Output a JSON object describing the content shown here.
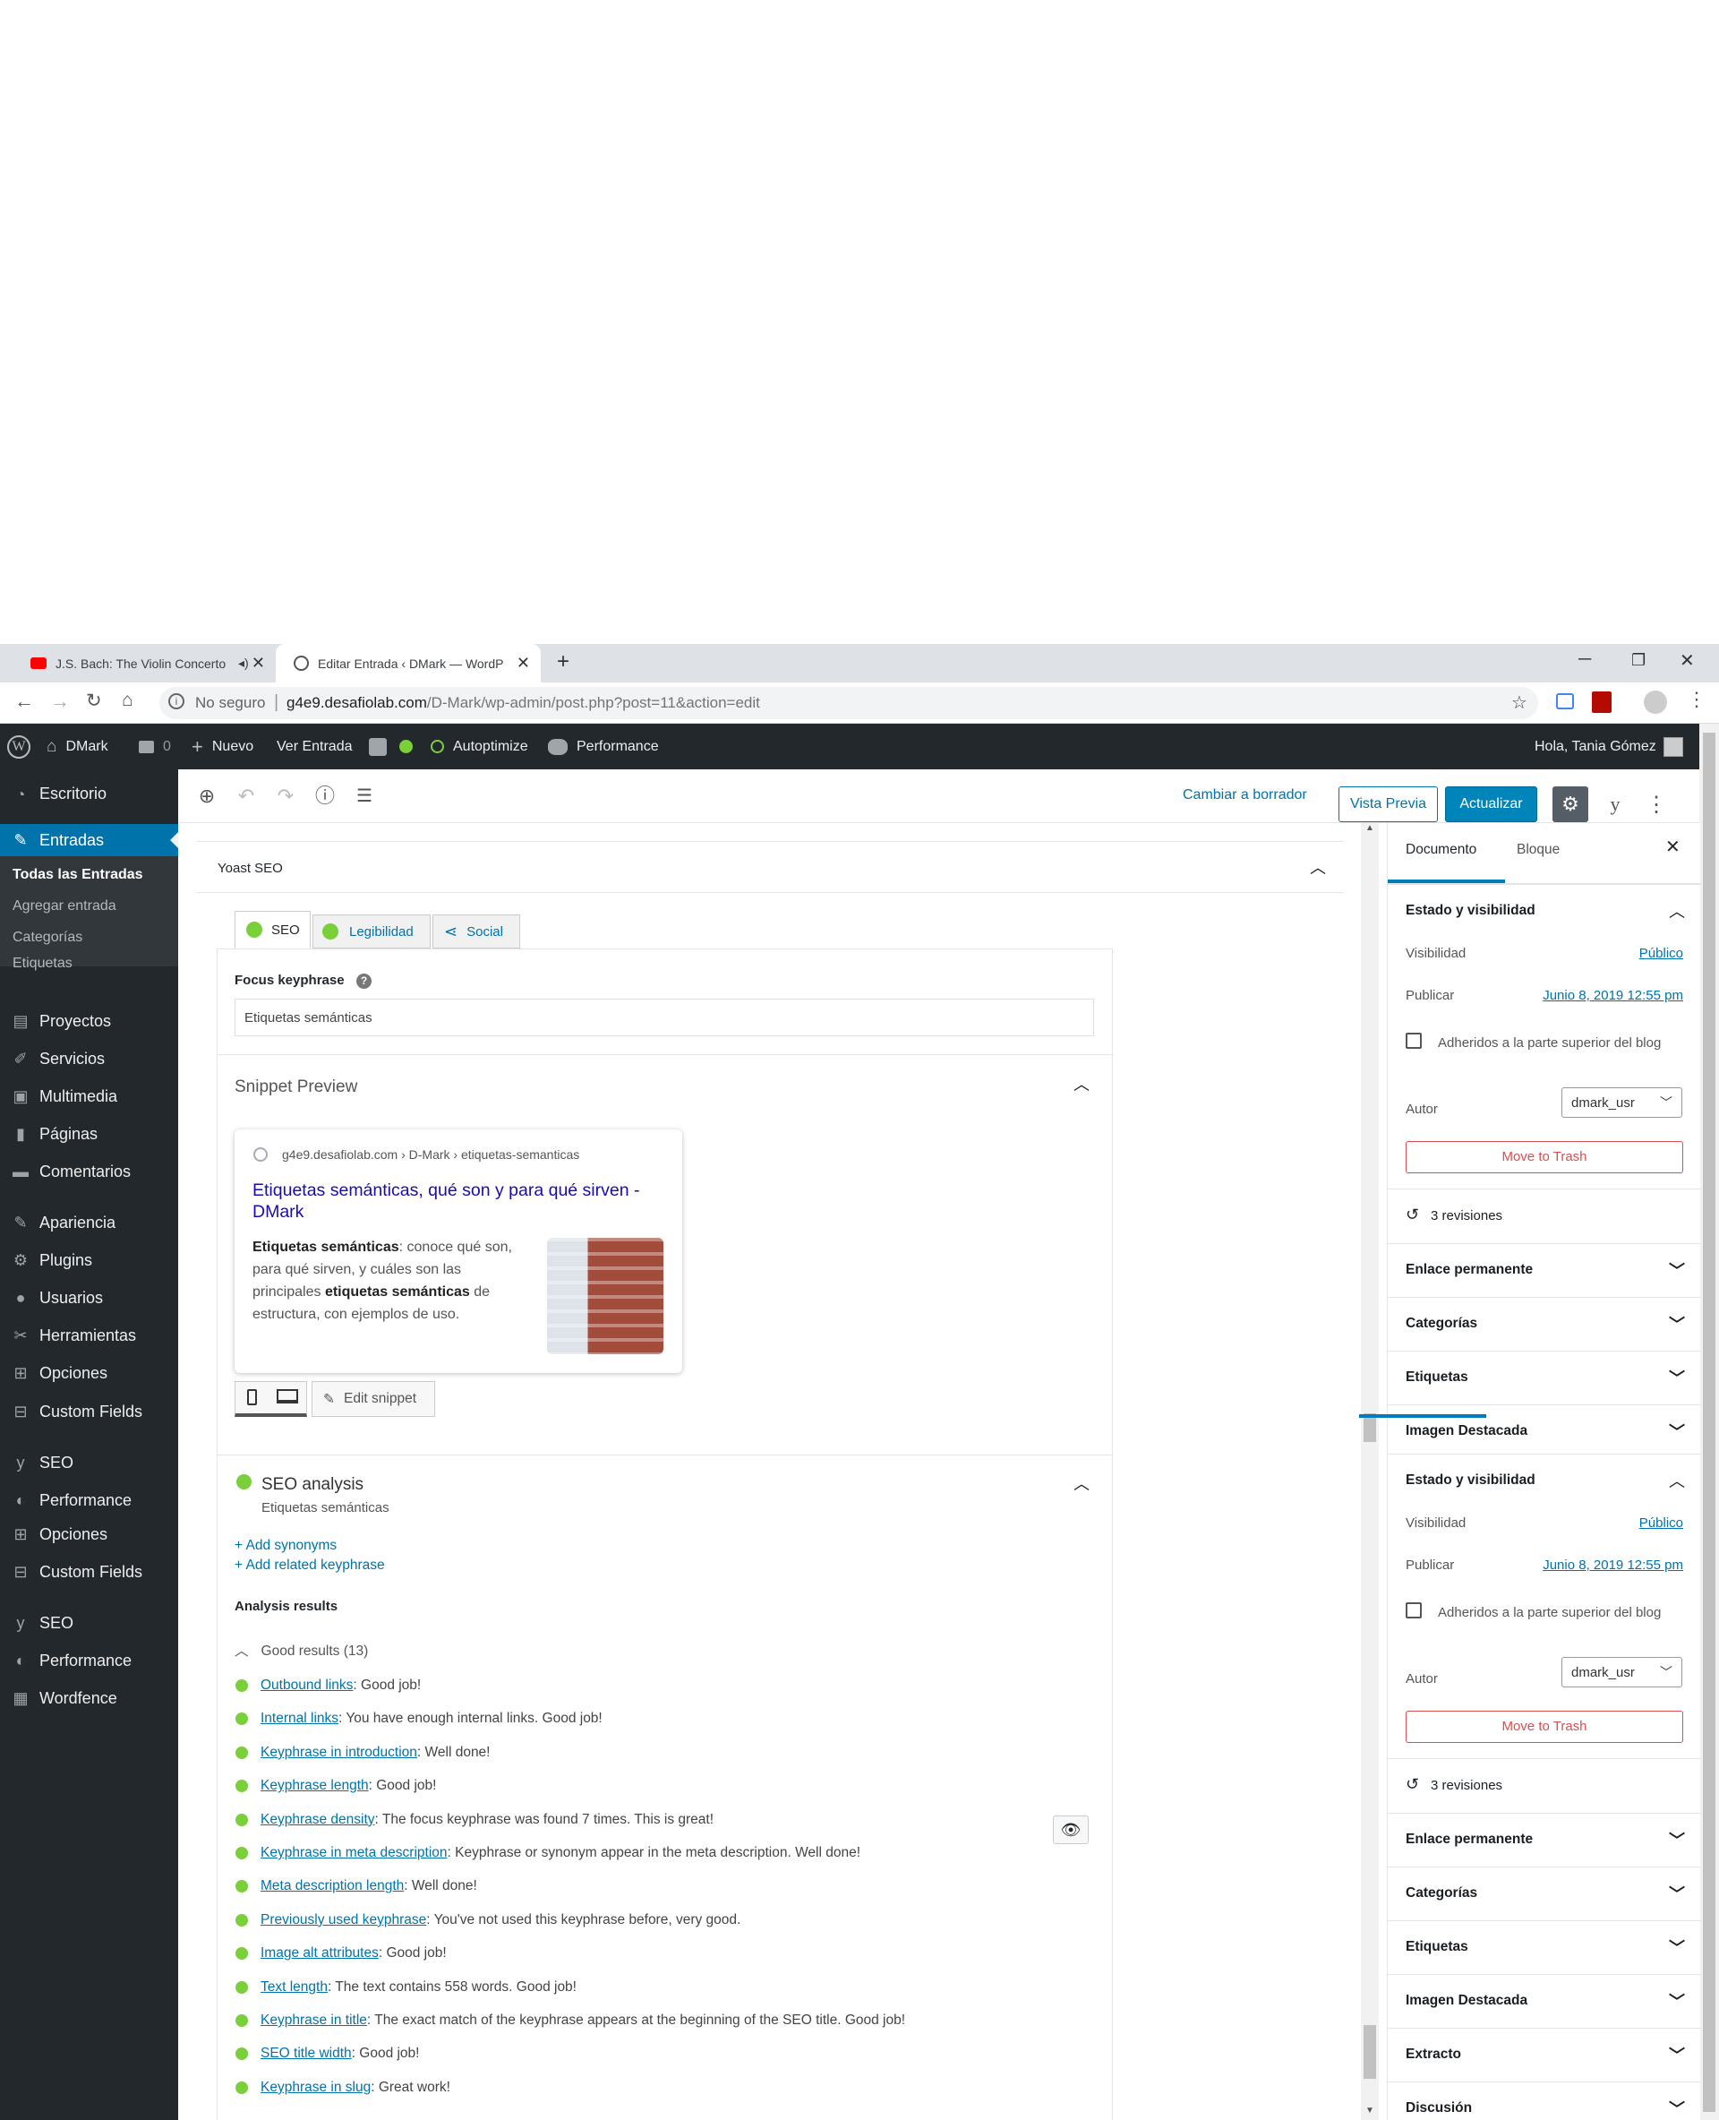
{
  "browser": {
    "tabs": [
      {
        "title": "J.S. Bach: The Violin Concerto",
        "audio": "speaker-icon"
      },
      {
        "title": "Editar Entrada ‹ DMark — WordP"
      }
    ],
    "new_tab": "+",
    "security": "No seguro",
    "url_host": "g4e9.desafiolab.com",
    "url_path": "/D-Mark/wp-admin/post.php?post=11&action=edit"
  },
  "adminbar": {
    "site": "DMark",
    "comments": "0",
    "new": "Nuevo",
    "view": "Ver Entrada",
    "autoptimize": "Autoptimize",
    "performance": "Performance",
    "greeting": "Hola, Tania Gómez"
  },
  "menu": {
    "dashboard": "Escritorio",
    "posts": "Entradas",
    "posts_sub": [
      "Todas las Entradas",
      "Agregar entrada",
      "Categorías",
      "Etiquetas"
    ],
    "items": [
      "Proyectos",
      "Servicios",
      "Multimedia",
      "Páginas",
      "Comentarios",
      "Apariencia",
      "Plugins",
      "Usuarios",
      "Herramientas",
      "Opciones",
      "Custom Fields",
      "SEO",
      "Performance",
      "Opciones",
      "Custom Fields",
      "SEO",
      "Performance",
      "Wordfence"
    ]
  },
  "toolbar": {
    "switch_draft": "Cambiar a borrador",
    "preview": "Vista Previa",
    "update": "Actualizar"
  },
  "yoast": {
    "title": "Yoast SEO",
    "tabs": [
      "SEO",
      "Legibilidad",
      "Social"
    ],
    "focus_label": "Focus keyphrase",
    "focus_value": "Etiquetas semánticas",
    "snippet_title": "Snippet Preview",
    "snippet_url": "g4e9.desafiolab.com › D-Mark › etiquetas-semanticas",
    "snippet_headline": "Etiquetas semánticas, qué son y para qué sirven - DMark",
    "snippet_desc_b1": "Etiquetas semánticas",
    "snippet_desc_1": ": conoce qué son, para qué sirven, y cuáles son las principales ",
    "snippet_desc_b2": "etiquetas semánticas",
    "snippet_desc_2": " de estructura, con ejemplos de uso.",
    "edit_snippet": "Edit snippet",
    "analysis_title": "SEO analysis",
    "analysis_sub": "Etiquetas semánticas",
    "add_synonyms": "+ Add synonyms",
    "add_related": "+ Add related keyphrase",
    "results_heading": "Analysis results",
    "good_results": "Good results (13)",
    "results": [
      {
        "link": "Outbound links",
        "text": ": Good job!"
      },
      {
        "link": "Internal links",
        "text": ": You have enough internal links. Good job!"
      },
      {
        "link": "Keyphrase in introduction",
        "text": ": Well done!"
      },
      {
        "link": "Keyphrase length",
        "text": ": Good job!"
      },
      {
        "link": "Keyphrase density",
        "text": ": The focus keyphrase was found 7 times. This is great!"
      },
      {
        "link": "Keyphrase in meta description",
        "text": ": Keyphrase or synonym appear in the meta description. Well done!"
      },
      {
        "link": "Meta description length",
        "text": ": Well done!"
      },
      {
        "link": "Previously used keyphrase",
        "text": ": You've not used this keyphrase before, very good."
      },
      {
        "link": "Image alt attributes",
        "text": ": Good job!"
      },
      {
        "link": "Text length",
        "text": ": The text contains 558 words. Good job!"
      },
      {
        "link": "Keyphrase in title",
        "text": ": The exact match of the keyphrase appears at the beginning of the SEO title. Good job!"
      },
      {
        "link": "SEO title width",
        "text": ": Good job!"
      },
      {
        "link": "Keyphrase in slug",
        "text": ": Great work!"
      }
    ]
  },
  "sidebar": {
    "tab_document": "Documento",
    "tab_block": "Bloque",
    "status_title": "Estado y visibilidad",
    "visibility_label": "Visibilidad",
    "visibility_value": "Público",
    "publish_label": "Publicar",
    "publish_value": "Junio 8, 2019 12:55 pm",
    "sticky": "Adheridos a la parte superior del blog",
    "author_label": "Autor",
    "author_value": "dmark_usr",
    "trash": "Move to Trash",
    "revisions": "3 revisiones",
    "permalink": "Enlace permanente",
    "categories": "Categorías",
    "tags": "Etiquetas",
    "featured": "Imagen Destacada",
    "excerpt": "Extracto",
    "discussion": "Discusión"
  },
  "colors": {
    "wpblue": "#0073aa",
    "adminbar": "#23282d",
    "good": "#7ad03a"
  }
}
